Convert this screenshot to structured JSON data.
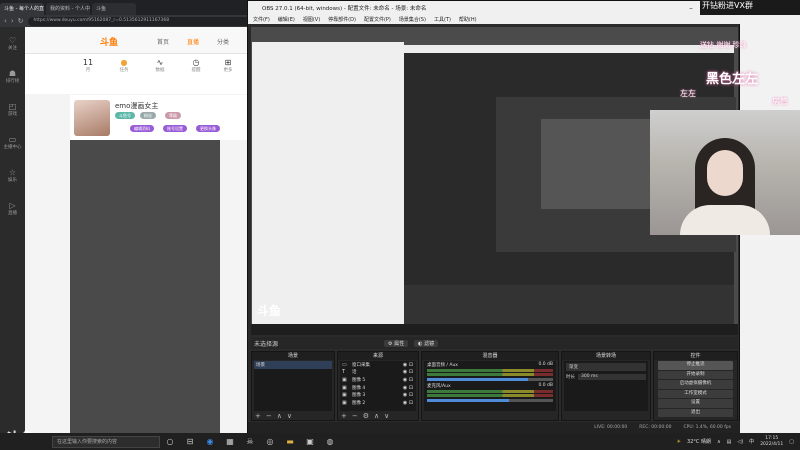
{
  "browser": {
    "tabs": [
      "斗鱼 - 每个人的直播平台",
      "我的资料 - 个人中心 - 斗鱼",
      "斗鱼"
    ],
    "url": "https://www.douyu.com/95162087_r=0.5135612911167368",
    "rail": [
      "关注",
      "排行榜",
      "游戏",
      "主播中心",
      "娱乐",
      "直播"
    ],
    "header": {
      "logo": "斗鱼",
      "nav": [
        "首页",
        "直播",
        "分类"
      ]
    },
    "stats": [
      {
        "value": "11",
        "label": "月"
      },
      {
        "value": "",
        "label": "任务"
      },
      {
        "value": "",
        "label": "数据"
      },
      {
        "value": "",
        "label": "提醒"
      },
      {
        "value": "",
        "label": "更多"
      }
    ],
    "profile": {
      "name": "emo漫画女主",
      "pills": [
        "斗鱼号",
        "粉丝",
        "等级"
      ],
      "buttons": [
        "编辑资料",
        "账号设置",
        "更换头像"
      ]
    },
    "watermark": "斗鱼"
  },
  "obs": {
    "title": "OBS 27.0.1 (64-bit, windows) - 配置文件: 未命名 - 场景: 未命名",
    "menu": [
      "文件(F)",
      "编辑(E)",
      "视图(V)",
      "停靠部件(D)",
      "配置文件(P)",
      "场景集合(S)",
      "工具(T)",
      "帮助(H)"
    ],
    "preview_logo": "斗鱼",
    "control_bar": {
      "label": "未选择源",
      "props": "属性",
      "filters": "滤镜"
    },
    "docks": {
      "scenes": {
        "title": "场景",
        "items": [
          "场景"
        ]
      },
      "sources": {
        "title": "来源",
        "items": [
          {
            "icon": "window-icon",
            "name": "窗口采集"
          },
          {
            "icon": "text-icon",
            "name": "话"
          },
          {
            "icon": "image-icon",
            "name": "图像 5"
          },
          {
            "icon": "image-icon",
            "name": "图像 4"
          },
          {
            "icon": "image-icon",
            "name": "图像 3"
          },
          {
            "icon": "image-icon",
            "name": "图像 2"
          }
        ]
      },
      "mixer": {
        "title": "混音器",
        "channels": [
          {
            "name": "桌面音频 / Aux",
            "db": "0.0 dB",
            "fill": 0.8
          },
          {
            "name": "麦克风/Aux",
            "db": "0.0 dB",
            "fill": 0.65
          }
        ]
      },
      "transitions": {
        "title": "场景转场",
        "type": "渐变",
        "duration_label": "时长",
        "duration": "300 ms"
      },
      "controls": {
        "title": "控件",
        "buttons": [
          "停止推流",
          "开始录制",
          "启动虚拟摄像机",
          "工作室模式",
          "设置",
          "退出"
        ]
      }
    },
    "status": {
      "live": "LIVE: 00:00:00",
      "rec": "REC: 00:00:00",
      "cpu": "CPU: 1.4%, 60.00 fps"
    }
  },
  "overlay": {
    "banner": "开钻粉进VX群",
    "line1": "送钻 谢谢 珍珠",
    "line2": "黑色左左",
    "line3": "房管",
    "line4": "左左"
  },
  "taskbar": {
    "search_placeholder": "在这里输入你要搜索的内容",
    "weather": "32°C 晴朗",
    "time": "17:15",
    "date": "2022/4/11",
    "lang": "中"
  },
  "colors": {
    "accent": "#ff7a00",
    "obs_bg": "#2b2b2b",
    "fader": "#4f8bd6"
  }
}
